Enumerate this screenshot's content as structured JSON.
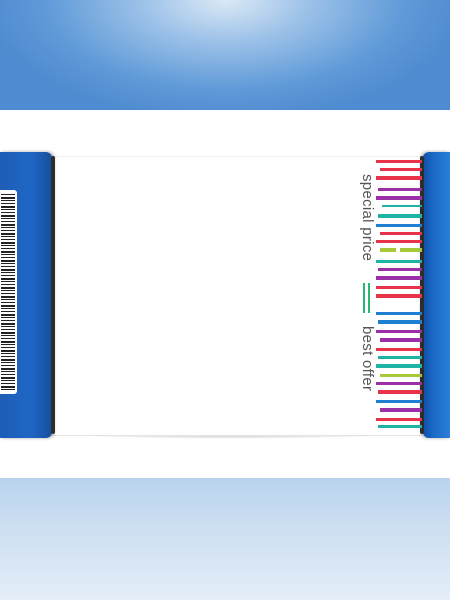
{
  "ticket": {
    "text_top": "special price",
    "text_bottom": "best offer"
  },
  "colors": {
    "background_top": "#5f9ad8",
    "background_bottom": "#cfe0f2",
    "stub_blue": "#1f66c4",
    "stripe_red": "#e8334a",
    "stripe_purple": "#9b2fa8",
    "stripe_teal": "#1fb3a5",
    "stripe_lime": "#a6c83a",
    "stripe_green": "#2bb673",
    "stripe_blue": "#1f7fd0",
    "text_gray": "#555555"
  },
  "icons": [
    "barcode-icon",
    "color-stripes-graphic"
  ]
}
